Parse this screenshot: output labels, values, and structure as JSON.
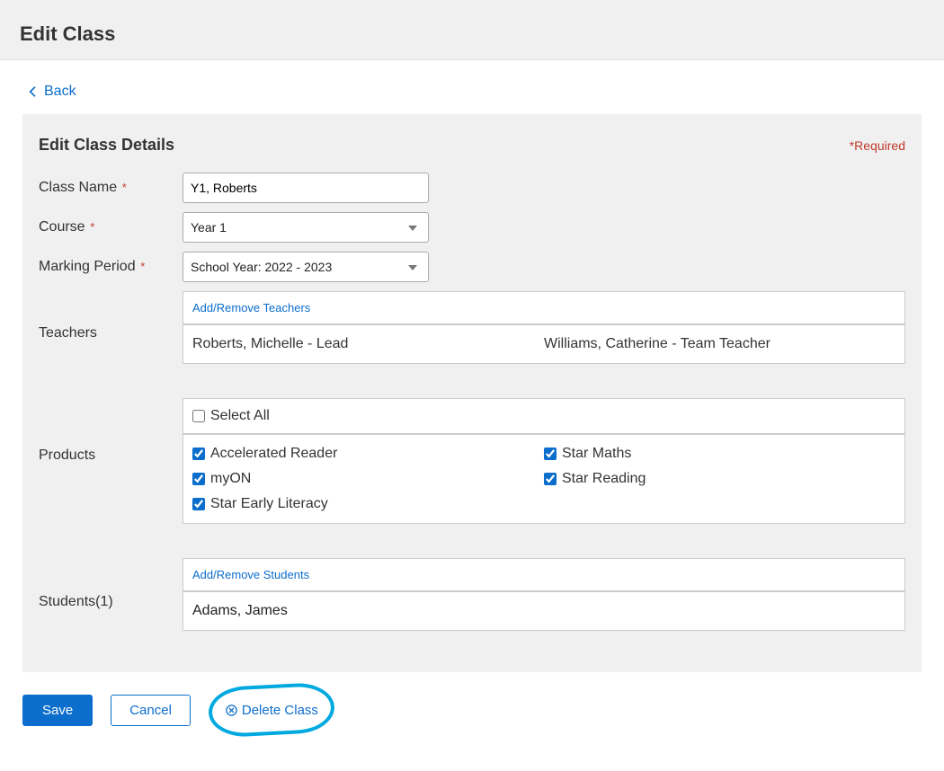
{
  "page": {
    "title": "Edit Class",
    "back_label": "Back"
  },
  "panel": {
    "title": "Edit Class Details",
    "required_label": "Required"
  },
  "labels": {
    "class_name": "Class Name",
    "course": "Course",
    "marking_period": "Marking Period",
    "teachers": "Teachers",
    "products": "Products",
    "students": "Students(1)",
    "add_remove_teachers": "Add/Remove Teachers",
    "add_remove_students": "Add/Remove Students",
    "select_all": "Select All"
  },
  "form": {
    "class_name_value": "Y1, Roberts",
    "course_value": "Year 1",
    "marking_period_value": "School Year: 2022 - 2023"
  },
  "teachers": {
    "0": "Roberts, Michelle - Lead",
    "1": "Williams, Catherine - Team Teacher"
  },
  "products": {
    "col1": {
      "0": "Accelerated Reader",
      "1": "myON",
      "2": "Star Early Literacy"
    },
    "col2": {
      "0": "Star Maths",
      "1": "Star Reading"
    }
  },
  "students": {
    "0": "Adams, James"
  },
  "actions": {
    "save": "Save",
    "cancel": "Cancel",
    "delete": "Delete Class"
  }
}
